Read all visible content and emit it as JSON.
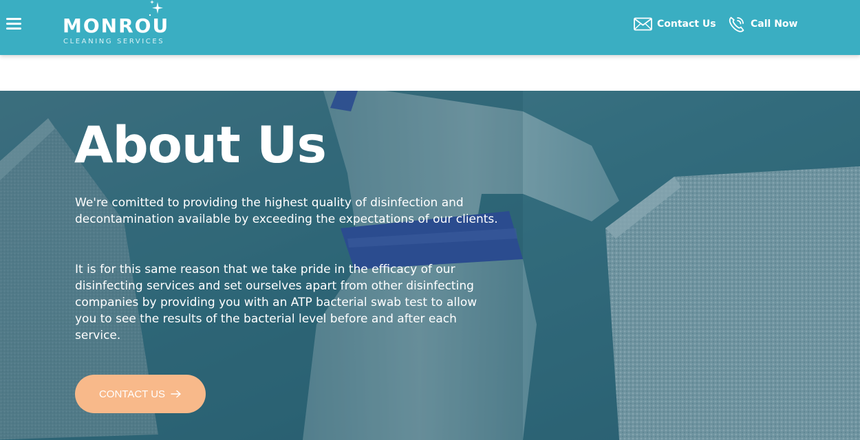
{
  "header": {
    "menu_icon": "hamburger-menu-icon",
    "logo": {
      "name": "MONROU",
      "tagline": "CLEANING SERVICES"
    },
    "nav": {
      "contact_label": "Contact Us",
      "contact_icon": "envelope-icon",
      "call_label": "Call Now",
      "call_icon": "phone-icon"
    }
  },
  "hero": {
    "title": "About Us",
    "paragraph_1": "We're comitted to providing the highest quality of disinfection and decontamination available by exceeding the expectations of our clients.",
    "paragraph_2": "It is for this same reason that we take pride in the efficacy of our disinfecting services and set ourselves apart from other disinfecting companies by providing you with an ATP bacterial swab test to allow you to see the results of the bacterial level before and after each service.",
    "cta_label": "CONTACT US",
    "cta_icon": "arrow-right-icon"
  },
  "colors": {
    "header_bg": "#3aaec2",
    "hero_overlay": "#2f6d80",
    "cta_bg": "#f8b98a",
    "text_light": "#ffffff"
  }
}
